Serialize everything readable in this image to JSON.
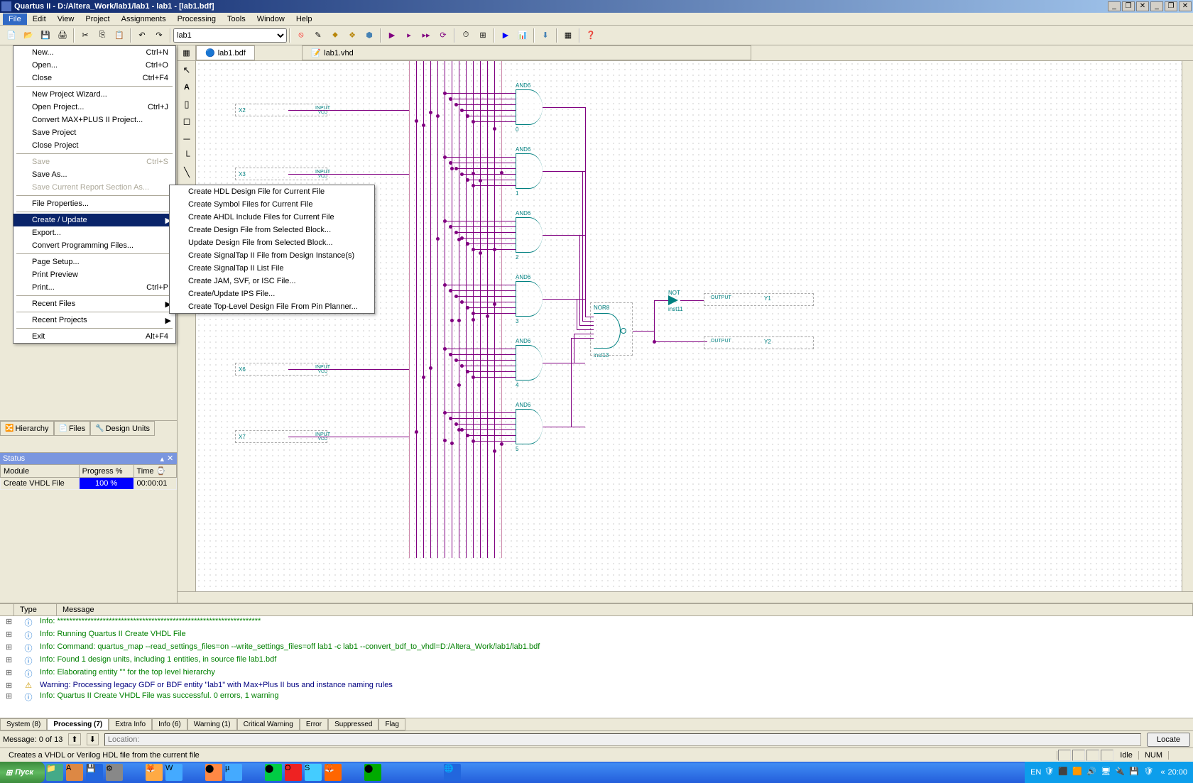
{
  "title": "Quartus II - D:/Altera_Work/lab1/lab1 - lab1 - [lab1.bdf]",
  "menubar": [
    "File",
    "Edit",
    "View",
    "Project",
    "Assignments",
    "Processing",
    "Tools",
    "Window",
    "Help"
  ],
  "toolbar_combo": "lab1",
  "doc_tabs": [
    {
      "icon": "bdf",
      "label": "lab1.bdf",
      "active": true
    },
    {
      "icon": "vhd",
      "label": "lab1.vhd",
      "active": false
    }
  ],
  "file_menu": [
    {
      "type": "item",
      "label": "New...",
      "shortcut": "Ctrl+N",
      "icon": "new"
    },
    {
      "type": "item",
      "label": "Open...",
      "shortcut": "Ctrl+O",
      "icon": "open"
    },
    {
      "type": "item",
      "label": "Close",
      "shortcut": "Ctrl+F4"
    },
    {
      "type": "sep"
    },
    {
      "type": "item",
      "label": "New Project Wizard...",
      "icon": "wizard"
    },
    {
      "type": "item",
      "label": "Open Project...",
      "shortcut": "Ctrl+J",
      "icon": "open-proj"
    },
    {
      "type": "item",
      "label": "Convert MAX+PLUS II Project..."
    },
    {
      "type": "item",
      "label": "Save Project"
    },
    {
      "type": "item",
      "label": "Close Project"
    },
    {
      "type": "sep"
    },
    {
      "type": "item",
      "label": "Save",
      "shortcut": "Ctrl+S",
      "icon": "save",
      "disabled": true
    },
    {
      "type": "item",
      "label": "Save As..."
    },
    {
      "type": "item",
      "label": "Save Current Report Section As...",
      "disabled": true
    },
    {
      "type": "sep"
    },
    {
      "type": "item",
      "label": "File Properties..."
    },
    {
      "type": "sep"
    },
    {
      "type": "item",
      "label": "Create / Update",
      "arrow": true,
      "highlighted": true
    },
    {
      "type": "item",
      "label": "Export..."
    },
    {
      "type": "item",
      "label": "Convert Programming Files..."
    },
    {
      "type": "sep"
    },
    {
      "type": "item",
      "label": "Page Setup...",
      "icon": "page"
    },
    {
      "type": "item",
      "label": "Print Preview",
      "icon": "preview"
    },
    {
      "type": "item",
      "label": "Print...",
      "shortcut": "Ctrl+P",
      "icon": "print"
    },
    {
      "type": "sep"
    },
    {
      "type": "item",
      "label": "Recent Files",
      "arrow": true
    },
    {
      "type": "sep"
    },
    {
      "type": "item",
      "label": "Recent Projects",
      "arrow": true
    },
    {
      "type": "sep"
    },
    {
      "type": "item",
      "label": "Exit",
      "shortcut": "Alt+F4"
    }
  ],
  "submenu": [
    {
      "label": "Create HDL Design File for Current File",
      "highlighted": true
    },
    {
      "label": "Create Symbol Files for Current File"
    },
    {
      "label": "Create AHDL Include Files for Current File"
    },
    {
      "type": "sep"
    },
    {
      "label": "Create Design File from Selected Block...",
      "disabled": true
    },
    {
      "label": "Update Design File from Selected Block...",
      "disabled": true
    },
    {
      "type": "sep"
    },
    {
      "label": "Create SignalTap II File from Design Instance(s)",
      "disabled": true
    },
    {
      "label": "Create SignalTap II List File",
      "disabled": true
    },
    {
      "label": "Create JAM, SVF, or ISC File...",
      "disabled": true
    },
    {
      "label": "Create/Update IPS File..."
    },
    {
      "type": "sep"
    },
    {
      "label": "Create Top-Level Design File From Pin Planner...",
      "disabled": true
    }
  ],
  "nav_tabs": [
    "Hierarchy",
    "Files",
    "Design Units"
  ],
  "status_header": "Status",
  "status_cols": [
    "Module",
    "Progress %",
    "Time ⌚"
  ],
  "status_row": {
    "module": "Create VHDL File",
    "progress": "100 %",
    "time": "00:00:01"
  },
  "schematic": {
    "inputs": [
      "X2",
      "X3",
      "X6",
      "X7"
    ],
    "and_gates": [
      "AND6",
      "AND6",
      "AND6",
      "AND6",
      "AND6",
      "AND6"
    ],
    "and_instances": [
      "0",
      "1",
      "2",
      "3",
      "4",
      "5"
    ],
    "nor": {
      "label": "NOR8",
      "inst": "inst13"
    },
    "not": {
      "label": "NOT",
      "inst": "inst11"
    },
    "outputs": [
      {
        "label": "OUTPUT",
        "name": "Y1"
      },
      {
        "label": "OUTPUT",
        "name": "Y2"
      }
    ],
    "input_label": "INPUT",
    "vcc": "VCC"
  },
  "messages": {
    "header_cols": [
      "Type",
      "Message"
    ],
    "lines": [
      {
        "type": "info",
        "text": "Info: *******************************************************************"
      },
      {
        "type": "info",
        "text": "Info: Running Quartus II Create VHDL File"
      },
      {
        "type": "info",
        "text": "Info: Command: quartus_map --read_settings_files=on --write_settings_files=off lab1 -c lab1 --convert_bdf_to_vhdl=D:/Altera_Work/lab1/lab1.bdf"
      },
      {
        "type": "info",
        "text": "Info: Found 1 design units, including 1 entities, in source file lab1.bdf"
      },
      {
        "type": "info",
        "text": "Info: Elaborating entity \"\" for the top level hierarchy"
      },
      {
        "type": "warn",
        "text": "Warning: Processing legacy GDF or BDF entity \"lab1\" with Max+Plus II bus and instance naming rules"
      },
      {
        "type": "info",
        "text": "Info: Quartus II Create VHDL File was successful. 0 errors, 1 warning"
      }
    ],
    "tabs": [
      "System (8)",
      "Processing (7)",
      "Extra Info",
      "Info (6)",
      "Warning (1)",
      "Critical Warning",
      "Error",
      "Suppressed",
      "Flag"
    ],
    "active_tab": 1
  },
  "msg_footer": {
    "label": "Message: 0 of 13",
    "location": "Location:",
    "locate_btn": "Locate"
  },
  "statusbar_hint": "Creates a VHDL or Verilog HDL file from the current file",
  "statusbar_idle": "Idle",
  "statusbar_num": "NUM",
  "taskbar": {
    "start": "Пуск",
    "lang": "EN",
    "time": "20:00"
  }
}
